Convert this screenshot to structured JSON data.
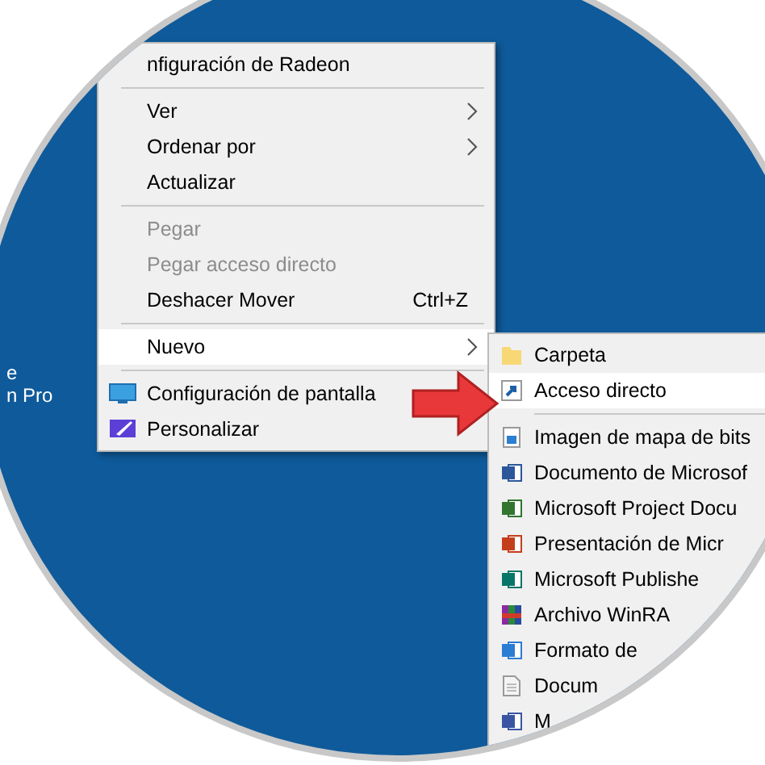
{
  "desktop_labels": [
    "e",
    "n Pro"
  ],
  "context_menu": [
    {
      "kind": "item",
      "label": "nfiguración de Radeon",
      "disabled": false,
      "selected": false,
      "has_submenu": false
    },
    {
      "kind": "separator"
    },
    {
      "kind": "item",
      "label": "Ver",
      "disabled": false,
      "selected": false,
      "has_submenu": true
    },
    {
      "kind": "item",
      "label": "Ordenar por",
      "disabled": false,
      "selected": false,
      "has_submenu": true
    },
    {
      "kind": "item",
      "label": "Actualizar",
      "disabled": false,
      "selected": false,
      "has_submenu": false
    },
    {
      "kind": "separator"
    },
    {
      "kind": "item",
      "label": "Pegar",
      "disabled": true,
      "selected": false,
      "has_submenu": false
    },
    {
      "kind": "item",
      "label": "Pegar acceso directo",
      "disabled": true,
      "selected": false,
      "has_submenu": false
    },
    {
      "kind": "item",
      "label": "Deshacer Mover",
      "shortcut": "Ctrl+Z",
      "disabled": false,
      "selected": false,
      "has_submenu": false
    },
    {
      "kind": "separator"
    },
    {
      "kind": "item",
      "label": "Nuevo",
      "disabled": false,
      "selected": true,
      "has_submenu": true
    },
    {
      "kind": "separator"
    },
    {
      "kind": "item",
      "label": "Configuración de pantalla",
      "disabled": false,
      "selected": false,
      "has_submenu": false
    },
    {
      "kind": "item",
      "label": "Personalizar",
      "disabled": false,
      "selected": false,
      "has_submenu": false
    }
  ],
  "submenu": [
    {
      "kind": "item",
      "label": "Carpeta",
      "selected": false
    },
    {
      "kind": "item",
      "label": "Acceso directo",
      "selected": true
    },
    {
      "kind": "separator"
    },
    {
      "kind": "item",
      "label": "Imagen de mapa de bits",
      "selected": false
    },
    {
      "kind": "item",
      "label": "Documento de Microsof",
      "selected": false
    },
    {
      "kind": "item",
      "label": "Microsoft Project Docu",
      "selected": false
    },
    {
      "kind": "item",
      "label": "Presentación de Micr",
      "selected": false
    },
    {
      "kind": "item",
      "label": "Microsoft Publishe",
      "selected": false
    },
    {
      "kind": "item",
      "label": "Archivo WinRA",
      "selected": false
    },
    {
      "kind": "item",
      "label": "Formato de",
      "selected": false
    },
    {
      "kind": "item",
      "label": "Docum",
      "selected": false
    },
    {
      "kind": "item",
      "label": "M",
      "selected": false
    }
  ]
}
